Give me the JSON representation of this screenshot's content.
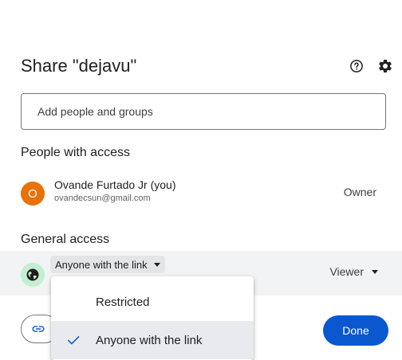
{
  "dialog": {
    "title": "Share \"dejavu\"",
    "help_icon": "help-circle-icon",
    "settings_icon": "gear-icon"
  },
  "add_people": {
    "placeholder": "Add people and groups"
  },
  "people_with_access": {
    "heading": "People with access",
    "people": [
      {
        "initial": "O",
        "name": "Ovande Furtado Jr (you)",
        "email": "ovandecsun@gmail.com",
        "role": "Owner",
        "avatar_color": "#e8710a"
      }
    ]
  },
  "general_access": {
    "heading": "General access",
    "icon": "globe-icon",
    "selected": "Anyone with the link",
    "role": "Viewer",
    "icon_bg_color": "#c4eed0"
  },
  "dropdown": {
    "options": [
      {
        "label": "Restricted",
        "selected": false
      },
      {
        "label": "Anyone with the link",
        "selected": true
      }
    ],
    "check_color": "#0b57d0"
  },
  "footer": {
    "copy_link_icon": "link-icon",
    "done_label": "Done",
    "done_color": "#0b57d0"
  }
}
